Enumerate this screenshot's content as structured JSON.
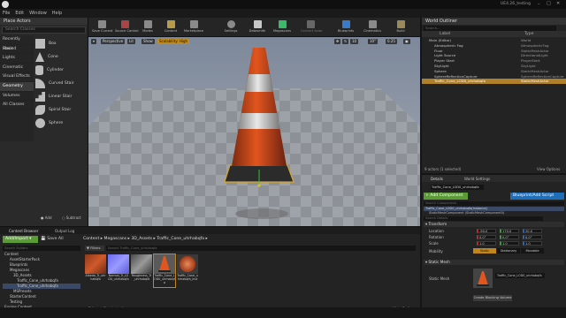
{
  "window": {
    "title": "UE4.26_testing"
  },
  "menu": {
    "items": [
      "File",
      "Edit",
      "Window",
      "Help"
    ]
  },
  "place_actors": {
    "tab": "Place Actors",
    "search_placeholder": "Search Classes",
    "categories": [
      "Recently Placed",
      "Basic",
      "Lights",
      "Cinematic",
      "Visual Effects",
      "Geometry",
      "Volumes",
      "All Classes"
    ],
    "selected_category": "Geometry",
    "items": [
      "Box",
      "Cone",
      "Cylinder",
      "Curved Stair",
      "Linear Stair",
      "Spiral Stair",
      "Sphere"
    ],
    "add_label": "Add",
    "subtract_label": "Subtract"
  },
  "toolbar": {
    "buttons": [
      "Save Current",
      "Source Control",
      "Modes",
      "Content",
      "Marketplace",
      "Settings",
      "Datasmith",
      "Megascans",
      "Convert Actor",
      "Blueprints",
      "Cinematics",
      "Build"
    ]
  },
  "viewport": {
    "perspective": "Perspective",
    "lit": "Lit",
    "show": "Show",
    "scalability": "Scalability: High",
    "grid_snap": "10",
    "angle_snap": "10°",
    "scale_snap": "0.25"
  },
  "outliner": {
    "tab": "World Outliner",
    "search_placeholder": "Search...",
    "col_label": "Label",
    "col_type": "Type",
    "rows": [
      {
        "label": "Main (Editor)",
        "type": "World"
      },
      {
        "label": "Atmospheric Fog",
        "type": "AtmosphericFog"
      },
      {
        "label": "Floor",
        "type": "StaticMeshActor"
      },
      {
        "label": "Light Source",
        "type": "DirectionalLight"
      },
      {
        "label": "Player Start",
        "type": "PlayerStart"
      },
      {
        "label": "SkyLight",
        "type": "SkyLight"
      },
      {
        "label": "Sphere",
        "type": "StaticMeshActor"
      },
      {
        "label": "SphereReflectionCapture",
        "type": "SphereReflectionCapture"
      },
      {
        "label": "Traffic_Cone_LOD0_uhrhabqfa",
        "type": "StaticMeshActor"
      }
    ],
    "selected_index": 8,
    "footer": "9 actors (1 selected)",
    "view_options": "View Options"
  },
  "details": {
    "tab": "Details",
    "world_settings_tab": "World Settings",
    "actor_name": "Traffic_Cone_LOD0_uhrhabqfa",
    "add_component": "+ Add Component",
    "blueprint": "Blueprint/Add Script",
    "search_components": "Search Components",
    "component_root": "Traffic_Cone_LOD0_uhrhabqfa(Instance)",
    "component_child": "StaticMeshComponent (StaticMeshComponent0)",
    "search_details": "Search Details",
    "transform_header": "Transform",
    "location_label": "Location",
    "rotation_label": "Rotation",
    "scale_label": "Scale",
    "mobility_label": "Mobility",
    "location": [
      "-90.0",
      "170.0",
      "20.0"
    ],
    "rotation": [
      "0.0°",
      "0.0°",
      "0.0°"
    ],
    "scale": [
      "1.0",
      "1.0",
      "1.0"
    ],
    "mobility": [
      "Static",
      "Stationary",
      "Movable"
    ],
    "static_mesh_header": "Static Mesh",
    "static_mesh_label": "Static Mesh",
    "static_mesh_value": "Traffic_Cone_LOD0_uhrhabqfa",
    "create_blocking": "Create Blocking Volume"
  },
  "content_browser": {
    "tab": "Content Browser",
    "output_tab": "Output Log",
    "add_import": "Add/Import",
    "save_all": "Save All",
    "breadcrumb": [
      "Content",
      "Megascans",
      "3D_Assets",
      "Traffic_Cone_uhrhabqfa"
    ],
    "search_folders": "Search Folders",
    "filters": "Filters",
    "search_assets": "Search Traffic_Cone_uhrhabqfa",
    "tree": [
      "Content",
      "AssetStarterPack",
      "Blueprints",
      "Megascans",
      "3D_Assets",
      "Traffic_Cone_uhrhabqfa",
      "Traffic_Cone_uhrhabqfa",
      "MSPresets",
      "StarterContent",
      "Testing",
      "Engine Content",
      "Engine C++ Classes"
    ],
    "selected_tree_index": 6,
    "assets": [
      "Albedo_Tr_uhrhabqfa",
      "Normal_Tr_LOD0_uhrhabqfa",
      "Roughness_Tr_uhrhabqfa",
      "Traffic_Cone_LOD0_uhrhabqfa",
      "Traffic_Cone_uhrhabqfa_inst"
    ],
    "status": "5 items (1 selected)",
    "view_options": "View Options"
  },
  "colors": {
    "accent_orange": "#b07f2a",
    "add_green": "#5a9b35",
    "blueprint_blue": "#1e6fb7",
    "cone_orange": "#e2551e"
  }
}
